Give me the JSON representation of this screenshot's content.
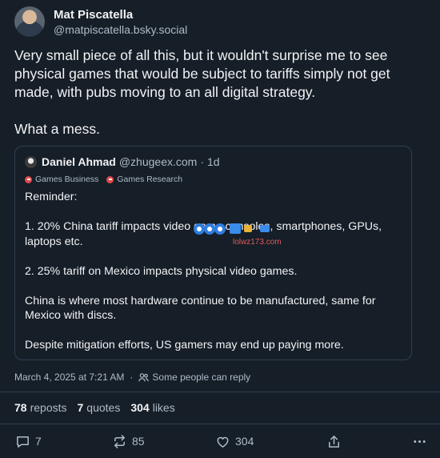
{
  "post": {
    "author_name": "Mat Piscatella",
    "author_handle": "@matpiscatella.bsky.social",
    "text": "Very small piece of all this, but it wouldn't surprise me to see physical games that would be subject to tariffs simply not get made, with pubs moving to an all digital strategy.\n\nWhat a mess.",
    "timestamp": "March 4, 2025 at 7:21 AM",
    "separator": "·",
    "reply_setting": "Some people can reply"
  },
  "quote": {
    "author_name": "Daniel Ahmad",
    "author_handle": "@zhugeex.com",
    "separator": "·",
    "time": "1d",
    "badges": [
      "Games Business",
      "Games Research"
    ],
    "text": "Reminder:\n\n1. 20% China tariff impacts video game consoles, smartphones, GPUs, laptops etc.\n\n2. 25% tariff on Mexico impacts physical video games.\n\nChina is where most hardware continue to be manufactured, same for Mexico with discs.\n\nDespite mitigation efforts, US gamers may end up paying more."
  },
  "watermark": {
    "text": "lolwz173.com"
  },
  "stats": {
    "reposts_count": "78",
    "reposts_label": "reposts",
    "quotes_count": "7",
    "quotes_label": "quotes",
    "likes_count": "304",
    "likes_label": "likes"
  },
  "actions": {
    "reply_count": "7",
    "repost_count": "85",
    "like_count": "304"
  },
  "icons": {
    "reply": "reply-icon",
    "repost": "repost-icon",
    "like": "heart-icon",
    "share": "share-icon",
    "more": "more-icon",
    "people": "people-icon"
  },
  "colors": {
    "background": "#161e27",
    "text": "#f1f3f5",
    "muted": "#aebbc9",
    "border": "#2e4052",
    "badge": "#e04a4a"
  }
}
